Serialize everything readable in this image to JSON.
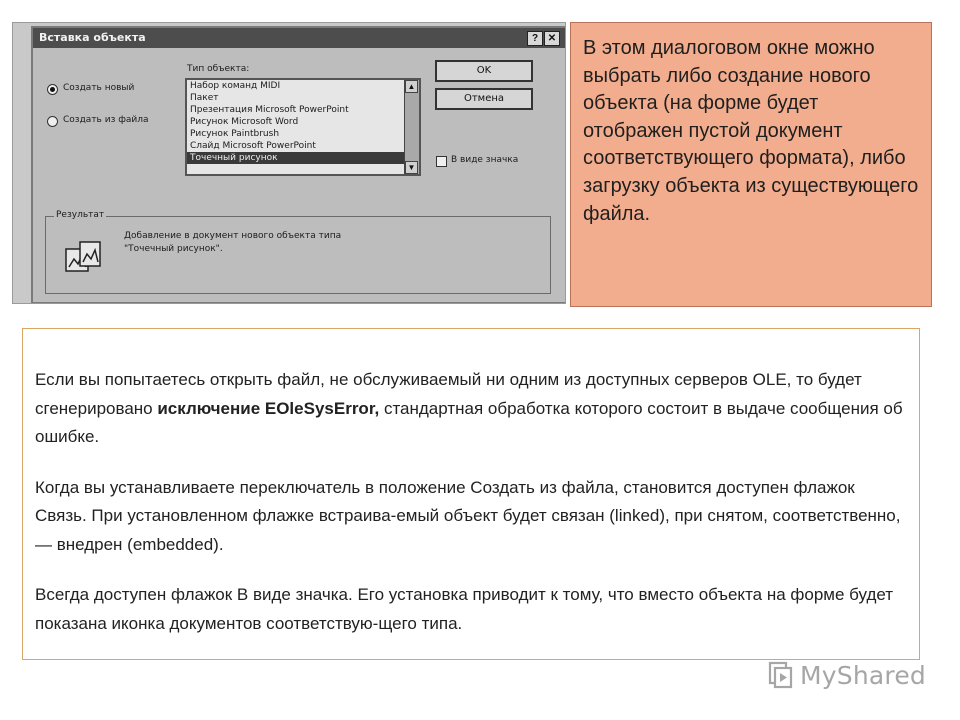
{
  "dialog": {
    "title": "Вставка объекта",
    "help_btn": "?",
    "close_btn": "✕",
    "radio_create_new": "Создать новый",
    "radio_create_from_file": "Создать из файла",
    "object_type_label": "Тип объекта:",
    "object_types": [
      "Набор команд MIDI",
      "Пакет",
      "Презентация Microsoft PowerPoint",
      "Рисунок Microsoft Word",
      "Рисунок Paintbrush",
      "Слайд Microsoft PowerPoint",
      "Точечный рисунок"
    ],
    "selected_object_type": "Точечный рисунок",
    "ok_button": "OK",
    "cancel_button": "Отмена",
    "as_icon_checkbox": "В виде значка",
    "result_label": "Результат",
    "result_line1": "Добавление в документ нового объекта типа",
    "result_line2": "\"Точечный рисунок\"."
  },
  "callout": {
    "text": "В этом диалоговом окне можно выбрать либо создание нового объекта (на форме будет отображен пустой документ соответствующего формата), либо загрузку объекта из существующего файла."
  },
  "body_text": {
    "p1_start": "Если вы попытаетесь открыть файл, не обслуживаемый ни одним из доступных серверов OLE, то будет сгенерировано ",
    "p1_bold": "исключение EOleSysError,",
    "p1_end": " стандартная обработка которого состоит в выдаче сообщения об ошибке.",
    "p2": "Когда вы устанавливаете переключатель в положение Создать из файла, становится доступен флажок Связь. При установленном флажке встраива-емый объект будет связан (linked), при снятом, соответственно, — внедрен (embedded).",
    "p3": "Всегда доступен флажок В виде значка. Его установка приводит к тому, что вместо объекта на форме будет показана иконка документов соответствую-щего типа."
  },
  "watermark": {
    "text": "MyShared"
  }
}
